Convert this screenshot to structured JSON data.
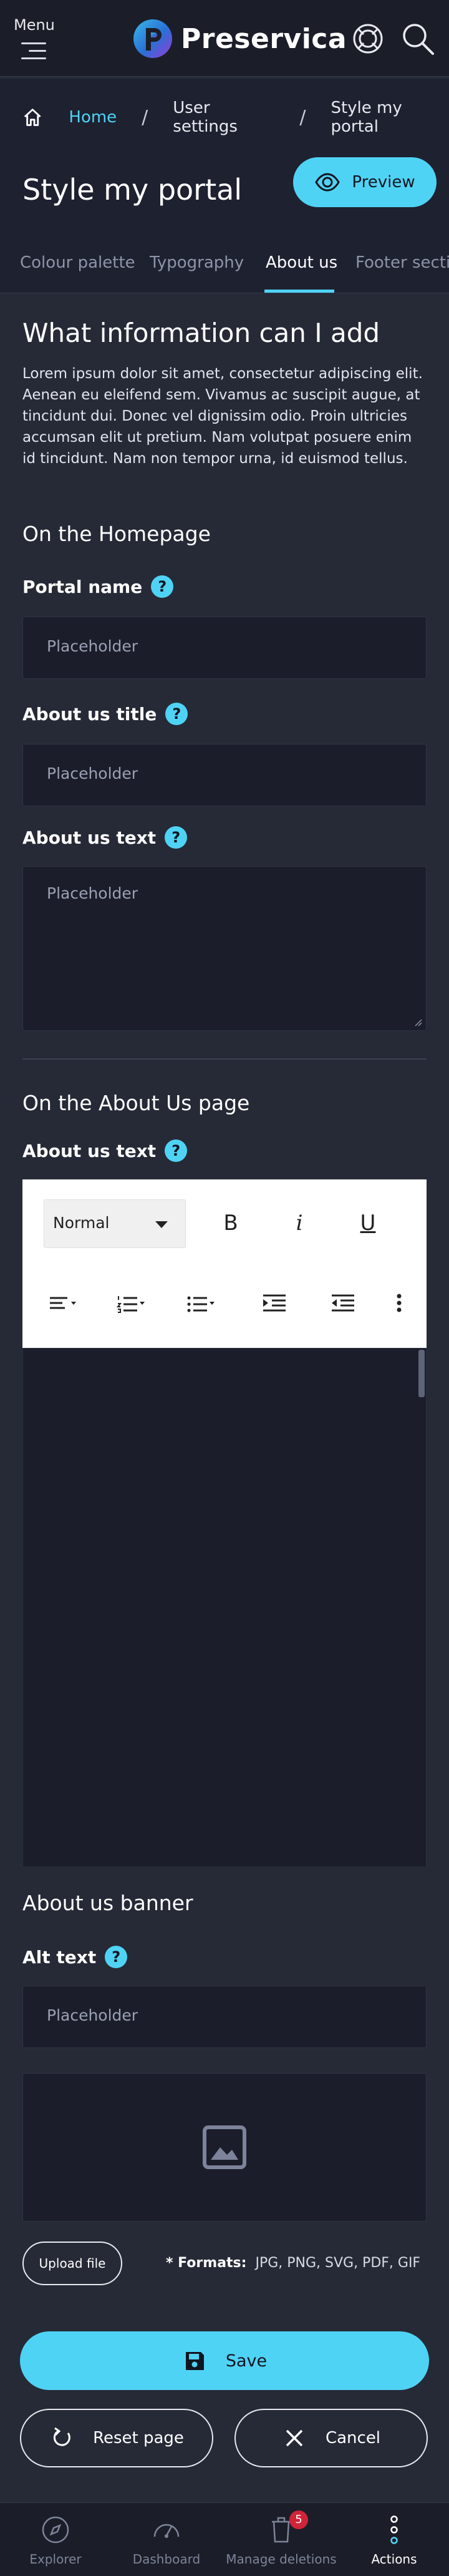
{
  "header": {
    "menu_label": "Menu",
    "brand_name": "Preservica",
    "icons": [
      "menu-icon",
      "help-icon",
      "search-icon"
    ]
  },
  "breadcrumb": {
    "home_icon": "home-icon",
    "items": [
      "Home",
      "User settings",
      "Style my portal"
    ]
  },
  "page": {
    "title": "Style my portal",
    "preview_label": "Preview"
  },
  "tabs": [
    {
      "label": "Colour palette",
      "active": false
    },
    {
      "label": "Typography",
      "active": false
    },
    {
      "label": "About us",
      "active": true
    },
    {
      "label": "Footer sectio",
      "active": false
    }
  ],
  "about": {
    "heading": "What information can I add",
    "intro": "Lorem ipsum dolor sit amet, consectetur adipiscing elit. Aenean eu eleifend sem. Vivamus ac suscipit augue, at tincidunt dui. Donec vel dignissim odio. Proin ultricies accumsan elit ut pretium. Nam volutpat posuere enim id tincidunt. Nam non tempor urna, id euismod tellus.",
    "homepage_section": "On the Homepage",
    "portal_name_label": "Portal name",
    "portal_name_placeholder": "Placeholder",
    "about_title_label": "About us title",
    "about_title_placeholder": "Placeholder",
    "about_text_label": "About us text",
    "about_text_placeholder": "Placeholder",
    "about_page_section": "On the About Us page",
    "about_page_text_label": "About us text",
    "editor": {
      "style_value": "Normal",
      "bold": "B",
      "italic": "i",
      "underline": "U"
    },
    "banner_heading": "About us banner",
    "alt_text_label": "Alt text",
    "alt_text_placeholder": "Placeholder",
    "upload_label": "Upload file",
    "formats_label": "* Formats:",
    "formats_value": "JPG, PNG, SVG, PDF, GIF",
    "help_glyph": "?"
  },
  "actions": {
    "save_label": "Save",
    "reset_label": "Reset page",
    "cancel_label": "Cancel"
  },
  "bottom_nav": {
    "items": [
      {
        "label": "Explorer",
        "icon": "explorer-icon",
        "active": false
      },
      {
        "label": "Dashboard",
        "icon": "dashboard-icon",
        "active": false
      },
      {
        "label": "Manage deletions",
        "icon": "deletions-icon",
        "active": false,
        "badge": "5"
      },
      {
        "label": "Actions",
        "icon": "actions-icon",
        "active": true
      }
    ]
  },
  "colors": {
    "accent": "#4fd3f5",
    "background": "#262a36",
    "header": "#1b1e28",
    "badge": "#d0243a"
  }
}
